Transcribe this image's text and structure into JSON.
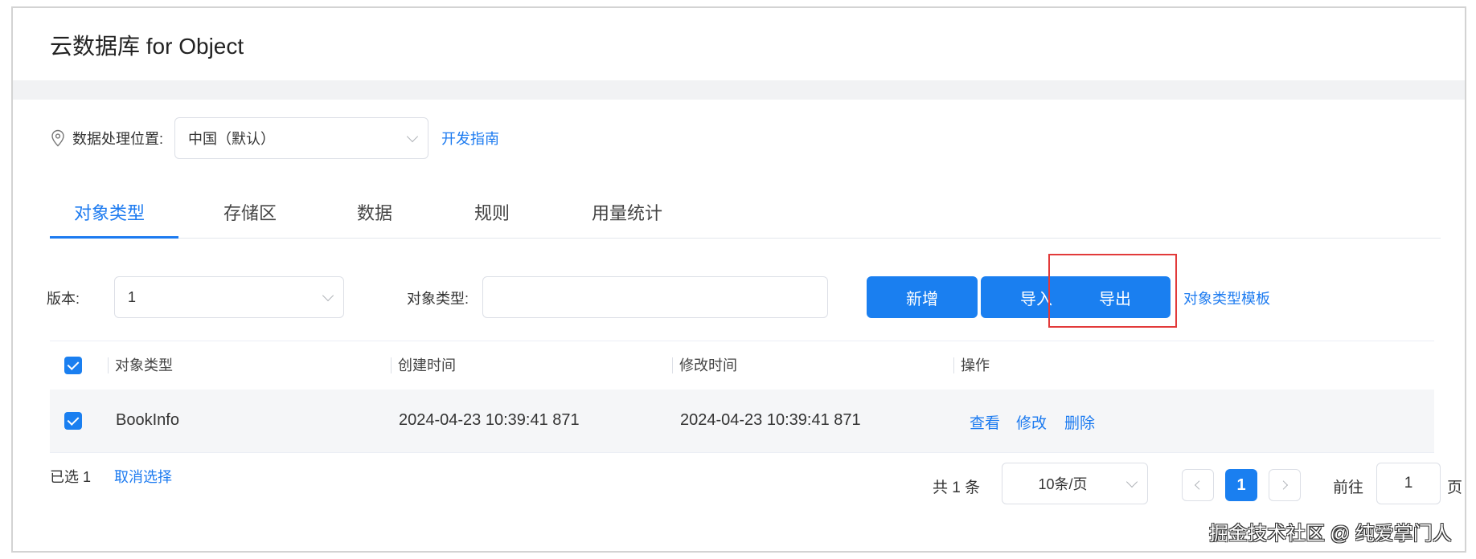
{
  "app": {
    "title": "云数据库 for Object"
  },
  "location": {
    "label": "数据处理位置:",
    "value": "中国（默认）",
    "guide_link": "开发指南"
  },
  "tabs": [
    {
      "label": "对象类型",
      "active": true
    },
    {
      "label": "存储区",
      "active": false
    },
    {
      "label": "数据",
      "active": false
    },
    {
      "label": "规则",
      "active": false
    },
    {
      "label": "用量统计",
      "active": false
    }
  ],
  "filters": {
    "version_label": "版本:",
    "version_value": "1",
    "type_label": "对象类型:",
    "type_value": ""
  },
  "actions": {
    "add": "新增",
    "import": "导入",
    "export": "导出",
    "template_link": "对象类型模板"
  },
  "table": {
    "columns": [
      "对象类型",
      "创建时间",
      "修改时间",
      "操作"
    ],
    "rows": [
      {
        "checked": true,
        "type": "BookInfo",
        "created": "2024-04-23 10:39:41 871",
        "modified": "2024-04-23 10:39:41 871",
        "ops": [
          "查看",
          "修改",
          "删除"
        ]
      }
    ]
  },
  "selection": {
    "count_text": "已选 1",
    "cancel": "取消选择"
  },
  "pagination": {
    "total": "共 1 条",
    "page_size": "10条/页",
    "current": "1",
    "goto_label": "前往",
    "goto_value": "1",
    "page_unit": "页"
  },
  "watermark": "掘金技术社区 @ 纯爱掌门人",
  "colors": {
    "accent": "#1a7ff0",
    "highlight_border": "#e23a3a"
  }
}
